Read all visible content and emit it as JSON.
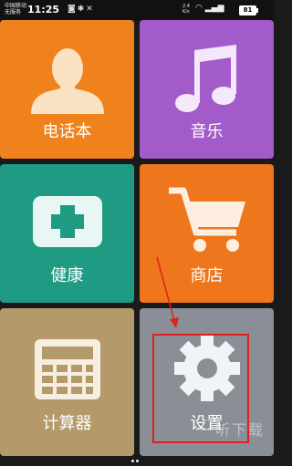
{
  "status_bar": {
    "carrier_line1": "中国移动",
    "carrier_line2": "无服务",
    "time": "11:25",
    "net_speed_value": "2.4",
    "net_speed_unit": "K/s",
    "battery": "81"
  },
  "tiles": [
    {
      "label": "电话本",
      "icon": "contact-person-icon",
      "color": "#f0821e"
    },
    {
      "label": "音乐",
      "icon": "music-note-icon",
      "color": "#a35bc9"
    },
    {
      "label": "健康",
      "icon": "medical-kit-icon",
      "color": "#1f9a83"
    },
    {
      "label": "商店",
      "icon": "shopping-cart-icon",
      "color": "#ee761c"
    },
    {
      "label": "计算器",
      "icon": "calculator-icon",
      "color": "#b49a6a"
    },
    {
      "label": "设置",
      "icon": "gear-icon",
      "color": "#8a8f97"
    }
  ],
  "annotation": {
    "highlight_color": "#e21f1f"
  },
  "watermark": "一听下载"
}
